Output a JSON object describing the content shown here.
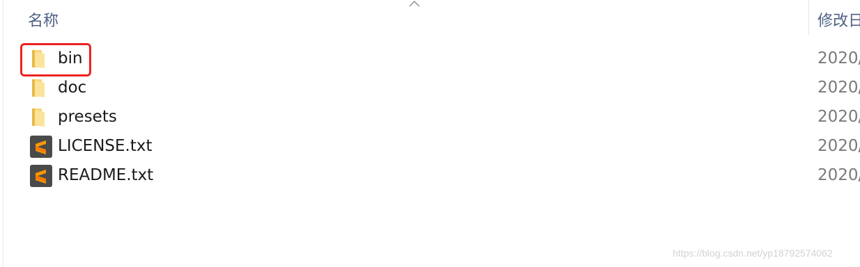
{
  "header": {
    "name_col": "名称",
    "date_col": "修改日"
  },
  "files": [
    {
      "name": "bin",
      "date": "2020/",
      "icon": "folder-icon"
    },
    {
      "name": "doc",
      "date": "2020/",
      "icon": "folder-icon"
    },
    {
      "name": "presets",
      "date": "2020/",
      "icon": "folder-icon"
    },
    {
      "name": "LICENSE.txt",
      "date": "2020/",
      "icon": "sublime-text-file-icon"
    },
    {
      "name": "README.txt",
      "date": "2020/",
      "icon": "sublime-text-file-icon"
    }
  ],
  "watermark": "https://blog.csdn.net/yp18792574062",
  "colors": {
    "header_text": "#4d6082",
    "highlight_box": "#ee2222",
    "folder": "#f8d775",
    "sublime_bg": "#4a4a4a",
    "sublime_accent": "#ff9800"
  }
}
